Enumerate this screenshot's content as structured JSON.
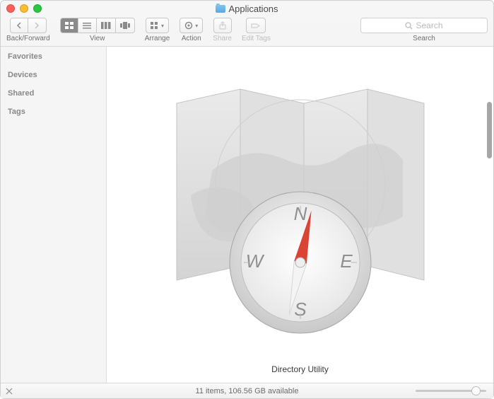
{
  "window": {
    "title": "Applications"
  },
  "toolbar": {
    "back_forward_label": "Back/Forward",
    "view_label": "View",
    "arrange_label": "Arrange",
    "action_label": "Action",
    "share_label": "Share",
    "tags_label": "Edit Tags",
    "search_label": "Search",
    "search_placeholder": "Search"
  },
  "sidebar": {
    "sections": [
      "Favorites",
      "Devices",
      "Shared",
      "Tags"
    ]
  },
  "main": {
    "selected_item": "Directory Utility"
  },
  "status": {
    "text": "11 items, 106.56 GB available"
  }
}
